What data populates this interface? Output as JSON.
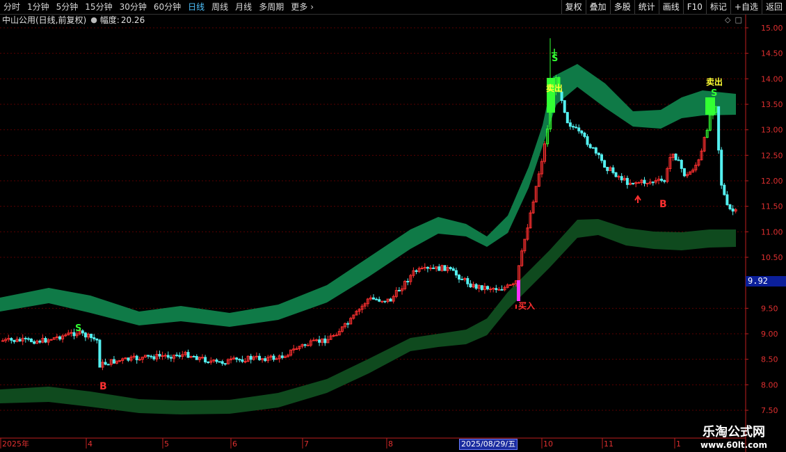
{
  "toolbar": {
    "periods": [
      "分时",
      "1分钟",
      "5分钟",
      "15分钟",
      "30分钟",
      "60分钟",
      "日线",
      "周线",
      "月线",
      "多周期",
      "更多"
    ],
    "active_period": "日线",
    "buttons": [
      "复权",
      "叠加",
      "多股",
      "统计",
      "画线",
      "F10",
      "标记",
      "+自选",
      "返回"
    ]
  },
  "info": {
    "title": "中山公用(日线,前复权)",
    "amplitude_label": "幅度:",
    "amplitude_value": "20.26"
  },
  "price_tag": "9.92",
  "date_tag": "2025/08/29/五",
  "watermark": {
    "cn": "乐淘公式网",
    "url": "www.60lt.com"
  },
  "chart_data": {
    "type": "candlestick",
    "y_ticks": [
      "15.00",
      "14.50",
      "14.00",
      "13.50",
      "13.00",
      "12.50",
      "12.00",
      "11.50",
      "11.00",
      "10.50",
      "9.50",
      "9.00",
      "8.50",
      "8.00",
      "7.50"
    ],
    "ylim": [
      7.5,
      15.0
    ],
    "x_labels": [
      "2025年",
      "4",
      "5",
      "6",
      "7",
      "8",
      "10",
      "11",
      "1"
    ],
    "signals": [
      "S",
      "B",
      "卖出",
      "S",
      "买入",
      "卖出",
      "S",
      "B"
    ],
    "colors": {
      "up": "#ff3030",
      "down": "#54f0f0",
      "upper_band": "#0f7a47",
      "lower_band": "#0f4a1e",
      "buy_bar": "#ff30ff",
      "signal_bar": "#33ff33",
      "sell_text": "#ffff33"
    }
  }
}
